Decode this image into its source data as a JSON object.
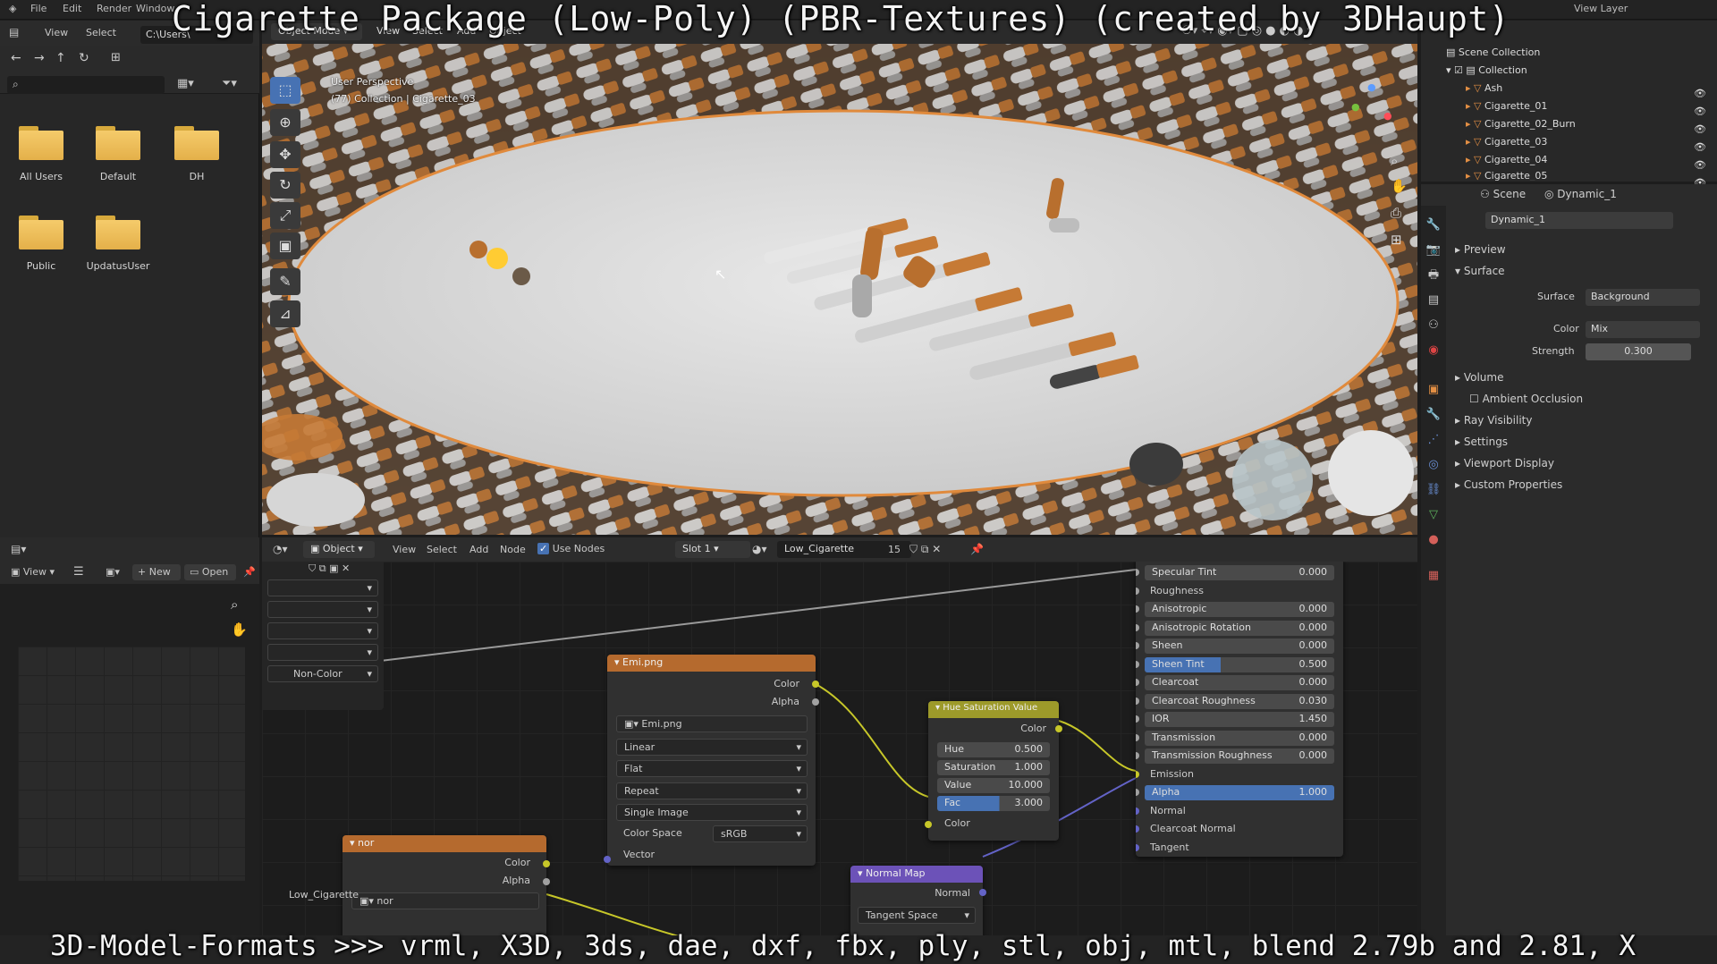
{
  "overlay": {
    "title": "Cigarette Package (Low-Poly) (PBR-Textures) (created by 3DHaupt)",
    "formats": "3D-Model-Formats >>> vrml, X3D, 3ds, dae, dxf, fbx, ply, stl, obj, mtl, blend 2.79b and 2.81, X"
  },
  "top_menu": [
    "File",
    "Edit",
    "Render",
    "Window"
  ],
  "top_right": "View Layer",
  "file_browser": {
    "menu": [
      "View",
      "Select"
    ],
    "path": "C:\\Users\\",
    "folders": [
      "All Users",
      "Default",
      "DH",
      "Public",
      "UpdatusUser"
    ]
  },
  "viewport": {
    "mode": "Object Mode",
    "menus": [
      "View",
      "Select",
      "Add",
      "Object"
    ],
    "perspective": "User Perspective",
    "collection_info": "(77) Collection | Cigarette_03"
  },
  "outliner": {
    "root": "Scene Collection",
    "collection": "Collection",
    "items": [
      "Ash",
      "Cigarette_01",
      "Cigarette_02_Burn",
      "Cigarette_03",
      "Cigarette_04",
      "Cigarette_05"
    ]
  },
  "properties": {
    "scene_label": "Scene",
    "world_label": "Dynamic_1",
    "world_name": "Dynamic_1",
    "panels_top": [
      "Preview",
      "Surface"
    ],
    "surface_label": "Surface",
    "surface_value": "Background",
    "color_label": "Color",
    "color_value": "Mix",
    "strength_label": "Strength",
    "strength_value": "0.300",
    "panels_bottom": [
      "Volume",
      "Ambient Occlusion",
      "Ray Visibility",
      "Settings",
      "Viewport Display",
      "Custom Properties"
    ]
  },
  "image_editor": {
    "view": "View",
    "new": "New",
    "open": "Open",
    "color_space": "Non-Color",
    "material_label": "Low_Cigarette"
  },
  "node_editor": {
    "mode": "Object",
    "menus": [
      "View",
      "Select",
      "Add",
      "Node"
    ],
    "use_nodes": "Use Nodes",
    "slot": "Slot 1",
    "material": "Low_Cigarette",
    "users": "15"
  },
  "nodes": {
    "emi": {
      "title": "Emi.png",
      "outputs": [
        "Color",
        "Alpha"
      ],
      "image": "Emi.png",
      "interpolation": "Linear",
      "projection": "Flat",
      "extension": "Repeat",
      "source": "Single Image",
      "color_space_label": "Color Space",
      "color_space": "sRGB",
      "input": "Vector"
    },
    "nor": {
      "title": "nor",
      "outputs": [
        "Color",
        "Alpha"
      ],
      "image": "nor"
    },
    "hsv": {
      "title": "Hue Saturation Value",
      "output": "Color",
      "fields": [
        {
          "label": "Hue",
          "value": "0.500"
        },
        {
          "label": "Saturation",
          "value": "1.000"
        },
        {
          "label": "Value",
          "value": "10.000"
        },
        {
          "label": "Fac",
          "value": "3.000"
        }
      ],
      "input": "Color"
    },
    "normal_map": {
      "title": "Normal Map",
      "output": "Normal",
      "space": "Tangent Space"
    },
    "bsdf": {
      "rows": [
        {
          "label": "Specular Tint",
          "value": "0.000",
          "kind": "field"
        },
        {
          "label": "Roughness",
          "value": "",
          "kind": "socket"
        },
        {
          "label": "Anisotropic",
          "value": "0.000",
          "kind": "field"
        },
        {
          "label": "Anisotropic Rotation",
          "value": "0.000",
          "kind": "field"
        },
        {
          "label": "Sheen",
          "value": "0.000",
          "kind": "field"
        },
        {
          "label": "Sheen Tint",
          "value": "0.500",
          "kind": "hl"
        },
        {
          "label": "Clearcoat",
          "value": "0.000",
          "kind": "field"
        },
        {
          "label": "Clearcoat Roughness",
          "value": "0.030",
          "kind": "field"
        },
        {
          "label": "IOR",
          "value": "1.450",
          "kind": "field"
        },
        {
          "label": "Transmission",
          "value": "0.000",
          "kind": "field"
        },
        {
          "label": "Transmission Roughness",
          "value": "0.000",
          "kind": "field"
        },
        {
          "label": "Emission",
          "value": "",
          "kind": "socket"
        },
        {
          "label": "Alpha",
          "value": "1.000",
          "kind": "full"
        },
        {
          "label": "Normal",
          "value": "",
          "kind": "socket"
        },
        {
          "label": "Clearcoat Normal",
          "value": "",
          "kind": "socket"
        },
        {
          "label": "Tangent",
          "value": "",
          "kind": "socket"
        }
      ]
    }
  },
  "colors": {
    "image_node_header": "#b56a2e",
    "hsv_node_header": "#9d9a2a",
    "normal_map_header": "#6c52b8",
    "selection_blue": "#4772b3",
    "socket_yellow": "#c7c729",
    "socket_purple": "#6363c7",
    "socket_grey": "#a1a1a1"
  }
}
